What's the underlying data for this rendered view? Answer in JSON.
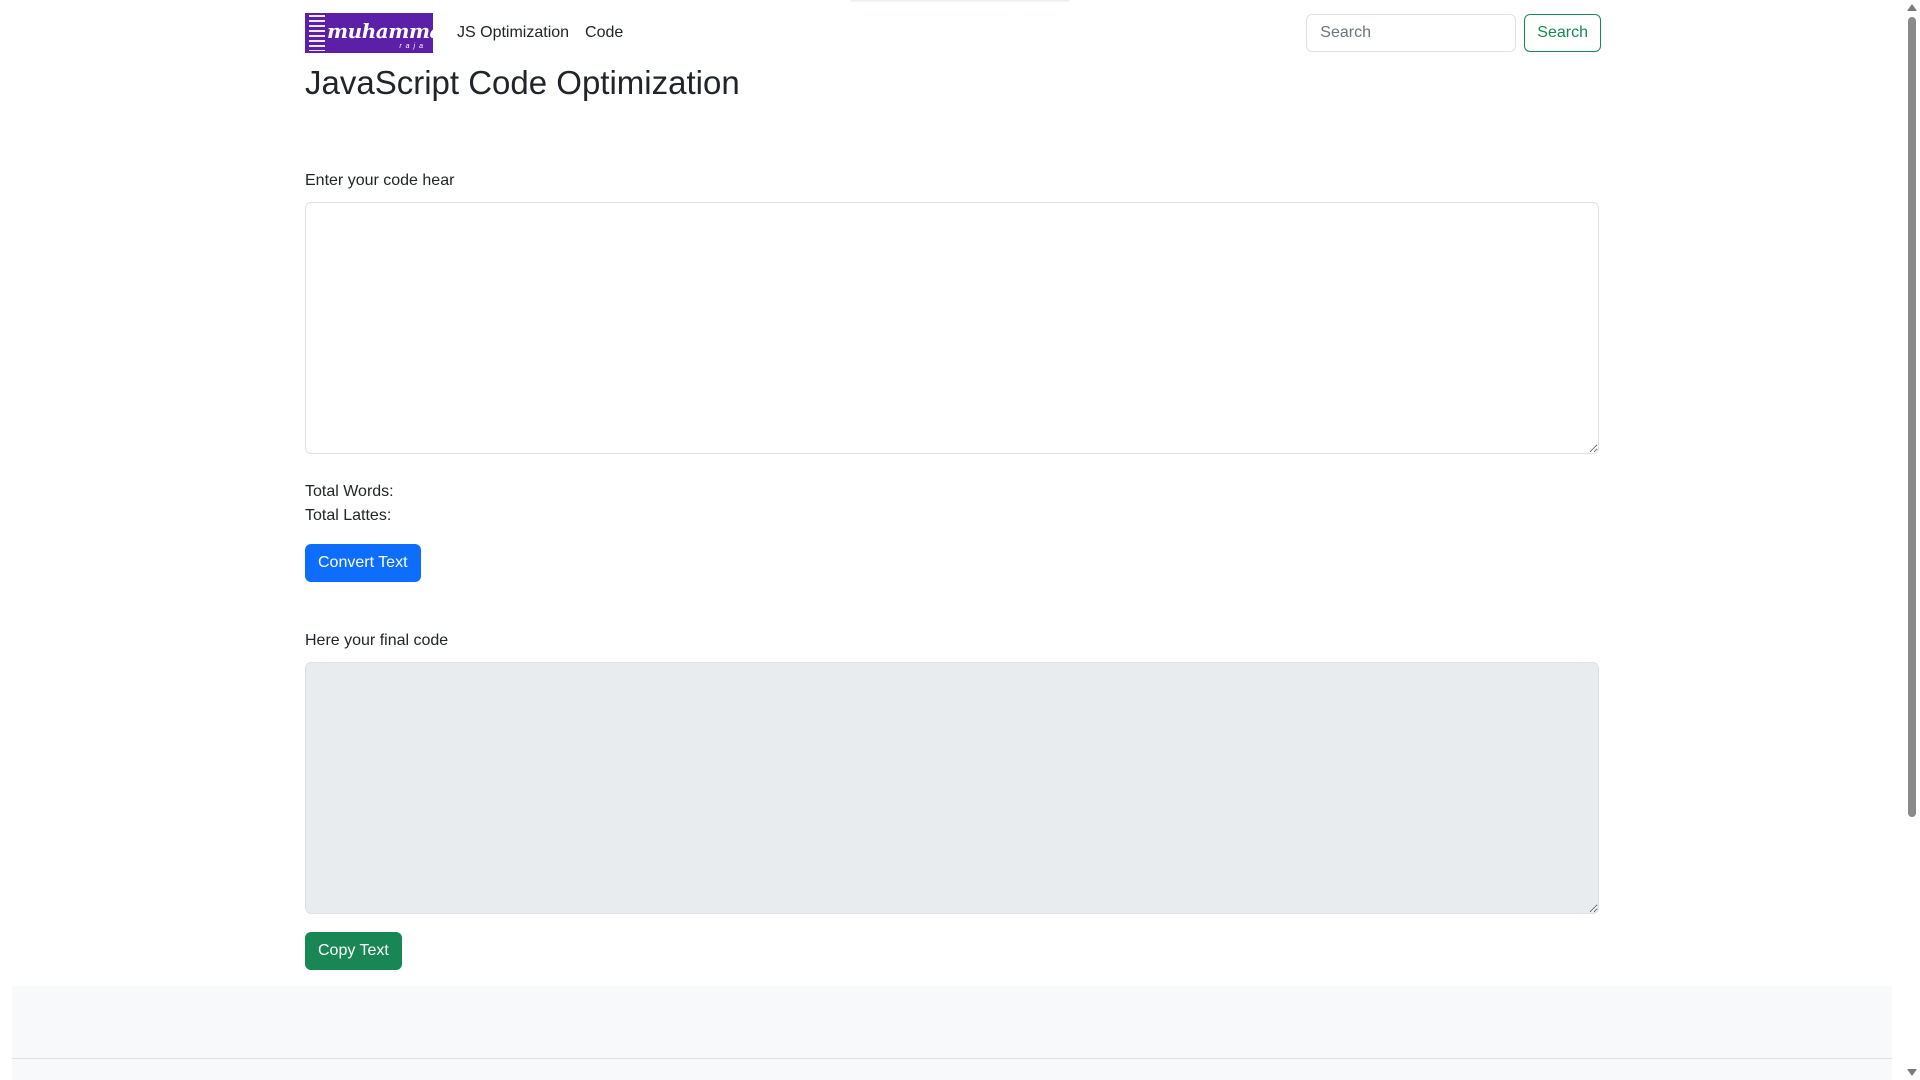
{
  "navbar": {
    "brand": {
      "logo_text": "muhammad",
      "logo_subtext": "raja",
      "icon": "brand-logo-icon"
    },
    "links": [
      {
        "label": "JS Optimization"
      },
      {
        "label": "Code"
      }
    ],
    "search": {
      "placeholder": "Search",
      "value": "",
      "button_label": "Search"
    }
  },
  "main": {
    "title": "JavaScript Code Optimization",
    "input": {
      "label": "Enter your code hear",
      "value": ""
    },
    "stats": {
      "words_label": "Total Words:",
      "letters_label": "Total Lattes:"
    },
    "convert_button": "Convert Text",
    "output": {
      "label": "Here your final code",
      "value": ""
    },
    "copy_button": "Copy Text"
  },
  "colors": {
    "brand": "#5b1fa8",
    "primary": "#0d6efd",
    "success": "#198754",
    "readonly_bg": "#e9ecef",
    "footer_bg": "#f8f9fa"
  }
}
